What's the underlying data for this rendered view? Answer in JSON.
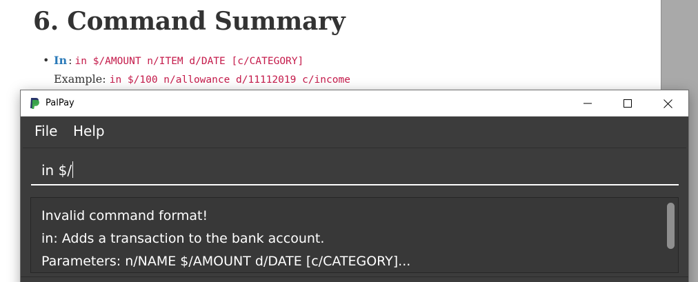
{
  "doc": {
    "heading": "6. Command Summary",
    "bullet": "•",
    "command_name": "In",
    "separator": ":",
    "command_syntax": "in $/AMOUNT n/ITEM d/DATE [c/CATEGORY]",
    "example_label": "Example:",
    "example_value": "in $/100 n/allowance d/11112019 c/income"
  },
  "window": {
    "title": "PalPay",
    "icon": "paypal-logo-icon",
    "controls": {
      "minimize": "minimize-icon",
      "maximize": "maximize-icon",
      "close": "close-icon"
    }
  },
  "menu": {
    "items": [
      {
        "label": "File"
      },
      {
        "label": "Help"
      }
    ]
  },
  "command_box": {
    "value": "in $/"
  },
  "result_box": {
    "lines": [
      "Invalid command format!",
      "in: Adds a transaction to the bank account.",
      "Parameters: n/NAME $/AMOUNT d/DATE [c/CATEGORY]..."
    ]
  },
  "colors": {
    "accent_link": "#2a7ab9",
    "code": "#c41a4a",
    "window_bg": "#3c3c3c",
    "text_light": "#ffffff"
  }
}
